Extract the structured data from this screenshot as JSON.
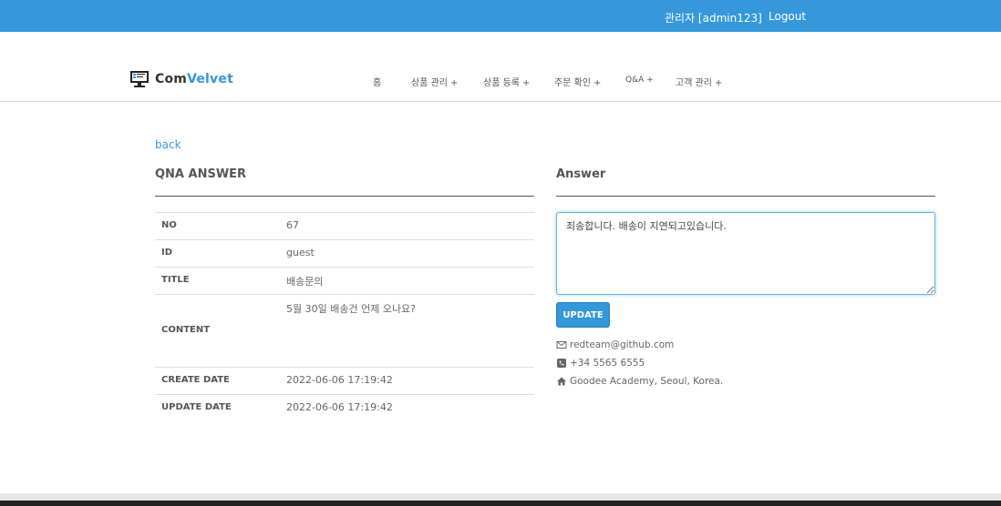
{
  "topbar": {
    "user": "관리자 [admin123]",
    "logout": "Logout"
  },
  "brand": {
    "name_part1": "Com",
    "name_part2": "Velvet"
  },
  "nav": [
    {
      "label": "홈",
      "plus": ""
    },
    {
      "label": "상품 관리",
      "plus": "+"
    },
    {
      "label": "상품 등록",
      "plus": "+"
    },
    {
      "label": "주문 확인",
      "plus": "+"
    },
    {
      "label": "Q&A",
      "plus": "+"
    },
    {
      "label": "고객 관리",
      "plus": "+"
    }
  ],
  "back": "back",
  "qna": {
    "title": "QNA ANSWER",
    "rows": [
      {
        "label": "NO",
        "value": "67"
      },
      {
        "label": "ID",
        "value": "guest"
      },
      {
        "label": "TITLE",
        "value": "배송문의"
      },
      {
        "label": "CONTENT",
        "value": "5월 30일 배송건 언제 오나요?"
      },
      {
        "label": "CREATE DATE",
        "value": "2022-06-06 17:19:42"
      },
      {
        "label": "UPDATE DATE",
        "value": "2022-06-06 17:19:42"
      }
    ]
  },
  "answer": {
    "title": "Answer",
    "text": "죄송합니다. 배송이 지연되고있습니다.",
    "button": "UPDATE"
  },
  "contact": {
    "email": "redteam@github.com",
    "phone": "+34 5565 6555",
    "address": "Goodee Academy, Seoul, Korea."
  },
  "colors": {
    "accent": "#3498db"
  }
}
